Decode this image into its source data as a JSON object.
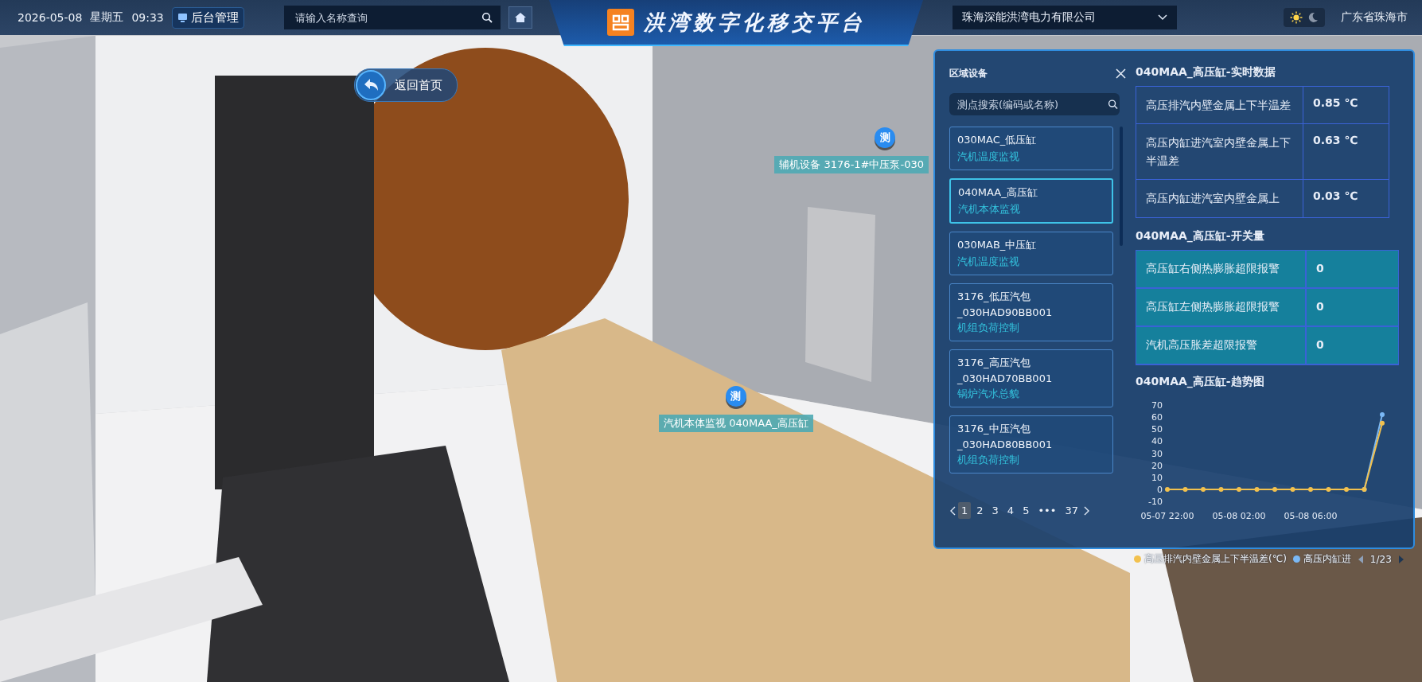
{
  "header": {
    "date": "2026-05-08",
    "weekday": "星期五",
    "time": "09:33",
    "admin_button": "后台管理",
    "search": {
      "placeholder": "请输入名称查询"
    },
    "title": "洪湾数字化移交平台",
    "company_select": "珠海深能洪湾电力有限公司",
    "theme": [
      {
        "kind": "sun",
        "selected": true
      },
      {
        "kind": "moon",
        "selected": false
      }
    ],
    "location": "广东省珠海市"
  },
  "back_button": "返回首页",
  "markers": [
    {
      "glyph": "测",
      "label": "辅机设备 3176-1#中压泵-030"
    },
    {
      "glyph": "测",
      "label": "汽机本体监视 040MAA_高压缸"
    }
  ],
  "panel": {
    "device_list": {
      "title": "区域设备",
      "search": {
        "placeholder": "测点搜索(编码或名称)"
      },
      "items": [
        {
          "lines": [
            "030MAC_低压缸"
          ],
          "category": "汽机温度监视",
          "selected": false
        },
        {
          "lines": [
            "040MAA_高压缸"
          ],
          "category": "汽机本体监视",
          "selected": true
        },
        {
          "lines": [
            "030MAB_中压缸"
          ],
          "category": "汽机温度监视",
          "selected": false
        },
        {
          "lines": [
            "3176_低压汽包",
            "_030HAD90BB001"
          ],
          "category": "机组负荷控制",
          "selected": false
        },
        {
          "lines": [
            "3176_高压汽包",
            "_030HAD70BB001"
          ],
          "category": "锅炉汽水总貌",
          "selected": false
        },
        {
          "lines": [
            "3176_中压汽包",
            "_030HAD80BB001"
          ],
          "category": "机组负荷控制",
          "selected": false
        }
      ],
      "pages": [
        {
          "label": "1",
          "selected": true
        },
        {
          "label": "2",
          "selected": false
        },
        {
          "label": "3",
          "selected": false
        },
        {
          "label": "4",
          "selected": false
        },
        {
          "label": "5",
          "selected": false
        },
        {
          "label": "•••",
          "selected": false
        },
        {
          "label": "37",
          "selected": false
        }
      ]
    },
    "realtime": {
      "title": "040MAA_高压缸-实时数据",
      "rows": [
        {
          "name": "高压排汽内壁金属上下半温差",
          "value": "0.85 ℃"
        },
        {
          "name": "高压内缸进汽室内壁金属上下半温差",
          "value": "0.63 ℃"
        },
        {
          "name": "高压内缸进汽室内壁金属上",
          "value": "0.03 ℃"
        }
      ]
    },
    "switches": {
      "title": "040MAA_高压缸-开关量",
      "rows": [
        {
          "name": "高压缸右侧热膨胀超限报警",
          "value": "0"
        },
        {
          "name": "高压缸左侧热膨胀超限报警",
          "value": "0"
        },
        {
          "name": "汽机高压胀差超限报警",
          "value": "0"
        }
      ]
    },
    "trend": {
      "title": "040MAA_高压缸-趋势图",
      "legend_pager": "1/23",
      "chart_data": {
        "type": "line",
        "categories": [
          "05-07 22:00",
          null,
          null,
          null,
          "05-08 02:00",
          null,
          null,
          null,
          "05-08 06:00",
          null,
          null,
          null,
          null
        ],
        "ylim": [
          -10,
          70
        ],
        "yticks": [
          -10,
          0,
          10,
          20,
          30,
          40,
          50,
          60,
          70
        ],
        "series": [
          {
            "name": "高压排汽内壁金属上下半温差(℃)",
            "color": "#f2c14e",
            "marker": true,
            "values": [
              0,
              0,
              0,
              0,
              0,
              0,
              0,
              0,
              0,
              0,
              0,
              0,
              55
            ]
          },
          {
            "name": "高压内缸进",
            "color": "#7ab8f5",
            "marker": true,
            "values": [
              null,
              null,
              null,
              null,
              null,
              null,
              null,
              null,
              null,
              null,
              null,
              0,
              62
            ]
          }
        ]
      }
    }
  }
}
